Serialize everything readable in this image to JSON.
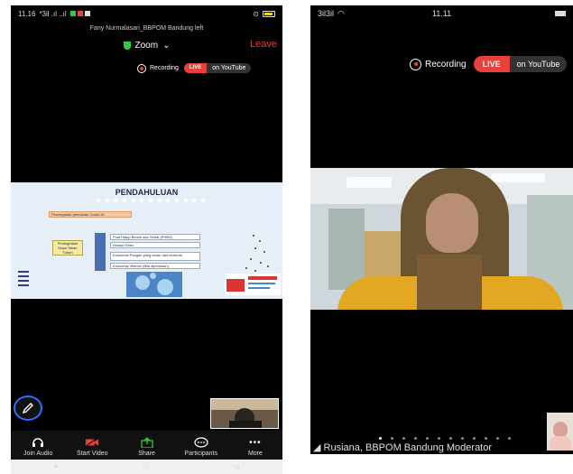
{
  "left": {
    "status": {
      "time": "11.16",
      "signal": "*3il .ıl ..ıl"
    },
    "meeting_title": "Fany Nurmalasari_BBPOM Bandung left",
    "app_title": "Zoom",
    "leave_label": "Leave",
    "recording_label": "Recording",
    "live_label": "LIVE",
    "youtube_label": "on YouTube",
    "slide": {
      "title": "PENDAHULUAN",
      "prevention": "Pencegahan penularan Covid-19",
      "boost": "Peningkatan Daya Tahan Tubuh",
      "items": [
        "Pola Hidup Bersih dan Sehat (PHBS)",
        "Hindari Stres",
        "Konsumsi Pangan yang aman dan bermutu",
        "Konsumsi Vitamin (Bila diperlukan)"
      ]
    },
    "toolbar": [
      {
        "label": "Join Audio",
        "icon": "headphones-icon"
      },
      {
        "label": "Start Video",
        "icon": "video-off-icon"
      },
      {
        "label": "Share",
        "icon": "share-icon"
      },
      {
        "label": "Participants",
        "icon": "participants-icon"
      },
      {
        "label": "More",
        "icon": "more-icon"
      }
    ]
  },
  "right": {
    "status": {
      "time": "11.11",
      "signal": "3il3il"
    },
    "recording_label": "Recording",
    "live_label": "LIVE",
    "youtube_label": "on YouTube",
    "speaker_name": "Rusiana, BBPOM Bandung Moderator"
  },
  "colors": {
    "live": "#e8403a",
    "leave": "#e8403a",
    "shield": "#2ecc40",
    "annotate_ring": "#2b70ff"
  }
}
